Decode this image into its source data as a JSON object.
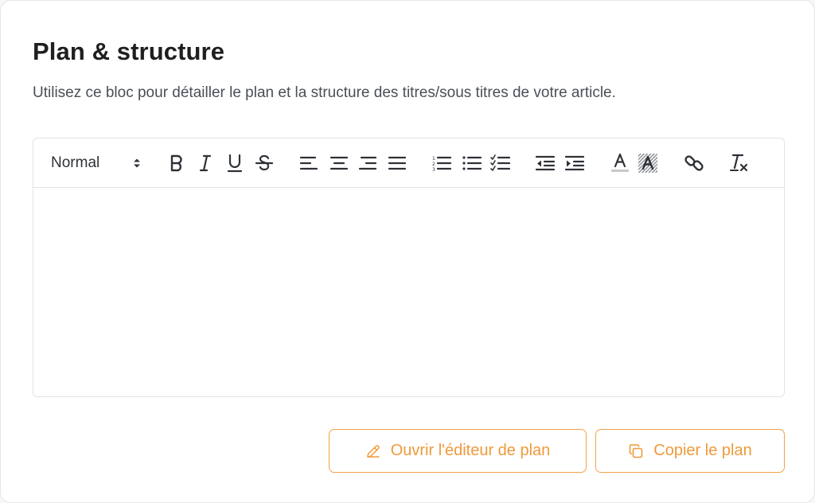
{
  "section": {
    "title": "Plan & structure",
    "description": "Utilisez ce bloc pour détailler le plan et la structure des titres/sous titres de votre article."
  },
  "editor": {
    "heading_select": {
      "selected": "Normal"
    },
    "toolbar_icons": [
      "bold-icon",
      "italic-icon",
      "underline-icon",
      "strike-icon",
      "align-left-icon",
      "align-center-icon",
      "align-right-icon",
      "align-justify-icon",
      "ordered-list-icon",
      "bullet-list-icon",
      "check-list-icon",
      "outdent-icon",
      "indent-icon",
      "text-color-icon",
      "highlight-icon",
      "link-icon",
      "clear-format-icon"
    ],
    "content": ""
  },
  "actions": {
    "open_editor_label": "Ouvrir l'éditeur de plan",
    "copy_label": "Copier le plan"
  },
  "colors": {
    "accent": "#ef9a3a",
    "border": "#e1e3e6",
    "title": "#1f1f1f",
    "text": "#4a4f57",
    "icon": "#2e3238"
  }
}
